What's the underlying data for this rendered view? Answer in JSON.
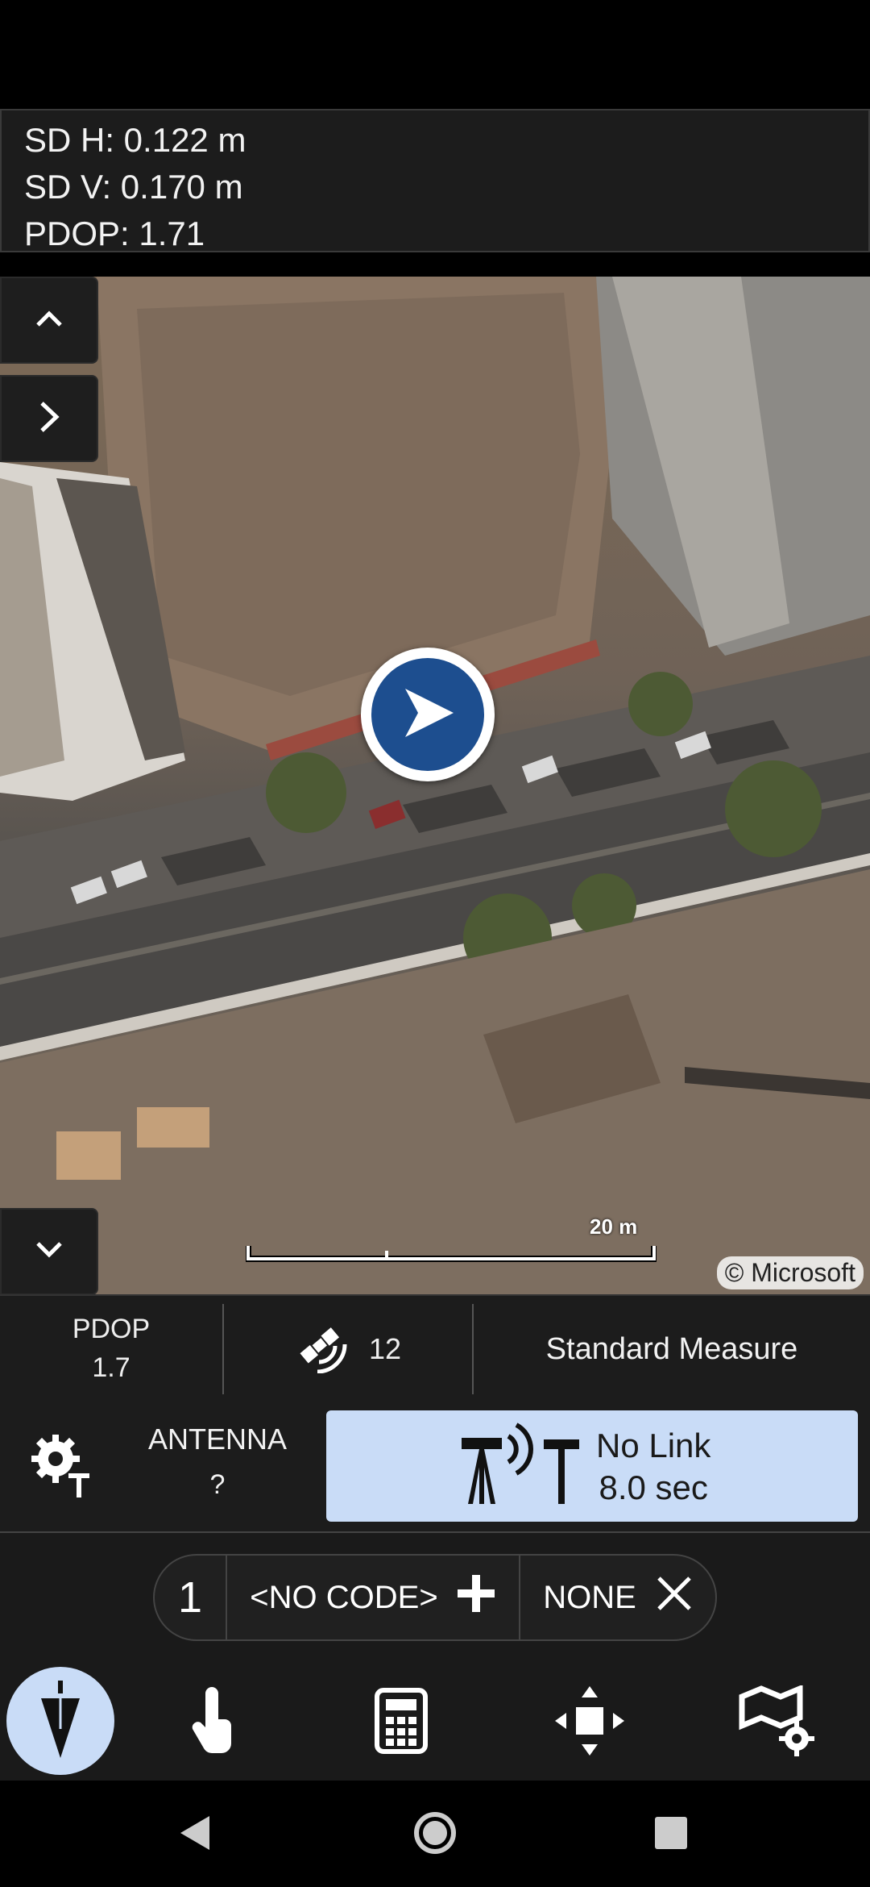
{
  "stats": {
    "sd_h": "SD H: 0.122 m",
    "sd_v": "SD V: 0.170 m",
    "pdop": "PDOP: 1.71"
  },
  "map": {
    "scale_label": "20 m",
    "copyright": "© Microsoft",
    "marker_color": "#1d4e8f"
  },
  "info": {
    "pdop_label": "PDOP",
    "pdop_value": "1.7",
    "satellites": "12",
    "mode": "Standard Measure",
    "antenna_label": "ANTENNA",
    "antenna_value": "?",
    "link_status": "No Link",
    "link_time": "8.0 sec",
    "link_bg": "#c9dcf7"
  },
  "code_bar": {
    "point_number": "1",
    "code": "<NO CODE>",
    "layer": "NONE"
  },
  "toolbar": {
    "items": [
      "measure-icon",
      "touch-icon",
      "calculator-icon",
      "zoom-extents-icon",
      "map-settings-icon"
    ]
  }
}
